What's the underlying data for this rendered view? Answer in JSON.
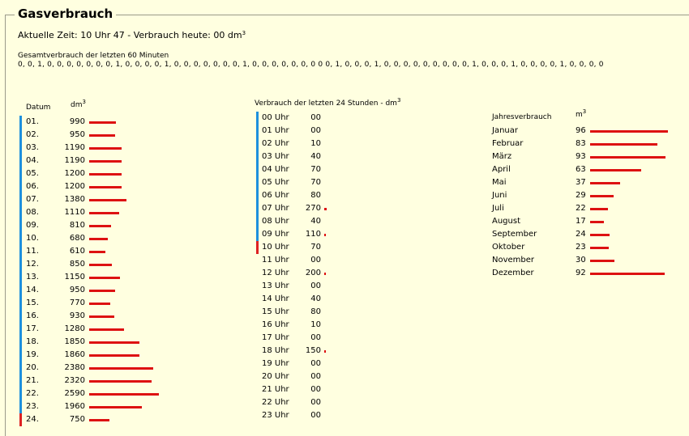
{
  "title": "Gasverbrauch",
  "current": {
    "label": "Aktuelle Zeit: 10 Uhr 47 - Verbrauch heute: 00 dm",
    "sup": "3"
  },
  "last60": {
    "label": "Gesamtverbrauch der letzten 60 Minuten",
    "values": "0, 0, 1, 0, 0, 0, 0, 0, 0, 0, 1, 0, 0, 0, 0, 1, 0, 0, 0, 0, 0, 0, 0, 1, 0, 0, 0, 0, 0, 0, 0 0 0, 1, 0, 0, 0, 1, 0, 0, 0, 0, 0, 0, 0, 0, 0, 1, 0, 0, 0, 1, 0, 0, 0, 0, 1, 0, 0, 0, 0"
  },
  "daily": {
    "col_date": "Datum",
    "col_unit": "dm",
    "col_unit_sup": "3",
    "line_colors": {
      "past": "#1e90dd",
      "current": "#dd2222"
    },
    "rows": [
      {
        "day": "01.",
        "value": "990",
        "amount": 990
      },
      {
        "day": "02.",
        "value": "950",
        "amount": 950
      },
      {
        "day": "03.",
        "value": "1190",
        "amount": 1190
      },
      {
        "day": "04.",
        "value": "1190",
        "amount": 1190
      },
      {
        "day": "05.",
        "value": "1200",
        "amount": 1200
      },
      {
        "day": "06.",
        "value": "1200",
        "amount": 1200
      },
      {
        "day": "07.",
        "value": "1380",
        "amount": 1380
      },
      {
        "day": "08.",
        "value": "1110",
        "amount": 1110
      },
      {
        "day": "09.",
        "value": "810",
        "amount": 810
      },
      {
        "day": "10.",
        "value": "680",
        "amount": 680
      },
      {
        "day": "11.",
        "value": "610",
        "amount": 610
      },
      {
        "day": "12.",
        "value": "850",
        "amount": 850
      },
      {
        "day": "13.",
        "value": "1150",
        "amount": 1150
      },
      {
        "day": "14.",
        "value": "950",
        "amount": 950
      },
      {
        "day": "15.",
        "value": "770",
        "amount": 770
      },
      {
        "day": "16.",
        "value": "930",
        "amount": 930
      },
      {
        "day": "17.",
        "value": "1280",
        "amount": 1280
      },
      {
        "day": "18.",
        "value": "1850",
        "amount": 1850
      },
      {
        "day": "19.",
        "value": "1860",
        "amount": 1860
      },
      {
        "day": "20.",
        "value": "2380",
        "amount": 2380
      },
      {
        "day": "21.",
        "value": "2320",
        "amount": 2320
      },
      {
        "day": "22.",
        "value": "2590",
        "amount": 2590
      },
      {
        "day": "23.",
        "value": "1960",
        "amount": 1960
      },
      {
        "day": "24.",
        "value": "750",
        "amount": 750,
        "current": true
      }
    ]
  },
  "hourly": {
    "title": "Verbrauch der letzten 24 Stunden - dm",
    "title_sup": "3",
    "rows": [
      {
        "hour": "00 Uhr",
        "value": "00",
        "amount": 0
      },
      {
        "hour": "01 Uhr",
        "value": "00",
        "amount": 0
      },
      {
        "hour": "02 Uhr",
        "value": "10",
        "amount": 10
      },
      {
        "hour": "03 Uhr",
        "value": "40",
        "amount": 40
      },
      {
        "hour": "04 Uhr",
        "value": "70",
        "amount": 70
      },
      {
        "hour": "05 Uhr",
        "value": "70",
        "amount": 70
      },
      {
        "hour": "06 Uhr",
        "value": "80",
        "amount": 80
      },
      {
        "hour": "07 Uhr",
        "value": "270",
        "amount": 270
      },
      {
        "hour": "08 Uhr",
        "value": "40",
        "amount": 40
      },
      {
        "hour": "09 Uhr",
        "value": "110",
        "amount": 110
      },
      {
        "hour": "10 Uhr",
        "value": "70",
        "amount": 70,
        "current": true
      },
      {
        "hour": "11 Uhr",
        "value": "00",
        "amount": 0
      },
      {
        "hour": "12 Uhr",
        "value": "200",
        "amount": 200
      },
      {
        "hour": "13 Uhr",
        "value": "00",
        "amount": 0
      },
      {
        "hour": "14 Uhr",
        "value": "40",
        "amount": 40
      },
      {
        "hour": "15 Uhr",
        "value": "80",
        "amount": 80
      },
      {
        "hour": "16 Uhr",
        "value": "10",
        "amount": 10
      },
      {
        "hour": "17 Uhr",
        "value": "00",
        "amount": 0
      },
      {
        "hour": "18 Uhr",
        "value": "150",
        "amount": 150
      },
      {
        "hour": "19 Uhr",
        "value": "00",
        "amount": 0
      },
      {
        "hour": "20 Uhr",
        "value": "00",
        "amount": 0
      },
      {
        "hour": "21 Uhr",
        "value": "00",
        "amount": 0
      },
      {
        "hour": "22 Uhr",
        "value": "00",
        "amount": 0
      },
      {
        "hour": "23 Uhr",
        "value": "00",
        "amount": 0
      }
    ]
  },
  "yearly": {
    "title": "Jahresverbrauch",
    "unit": "m",
    "unit_sup": "3",
    "rows": [
      {
        "month": "Januar",
        "value": "96",
        "amount": 96
      },
      {
        "month": "Februar",
        "value": "83",
        "amount": 83
      },
      {
        "month": "März",
        "value": "93",
        "amount": 93
      },
      {
        "month": "April",
        "value": "63",
        "amount": 63
      },
      {
        "month": "Mai",
        "value": "37",
        "amount": 37
      },
      {
        "month": "Juni",
        "value": "29",
        "amount": 29
      },
      {
        "month": "Juli",
        "value": "22",
        "amount": 22
      },
      {
        "month": "August",
        "value": "17",
        "amount": 17
      },
      {
        "month": "September",
        "value": "24",
        "amount": 24
      },
      {
        "month": "Oktober",
        "value": "23",
        "amount": 23
      },
      {
        "month": "November",
        "value": "30",
        "amount": 30
      },
      {
        "month": "Dezember",
        "value": "92",
        "amount": 92
      }
    ]
  }
}
